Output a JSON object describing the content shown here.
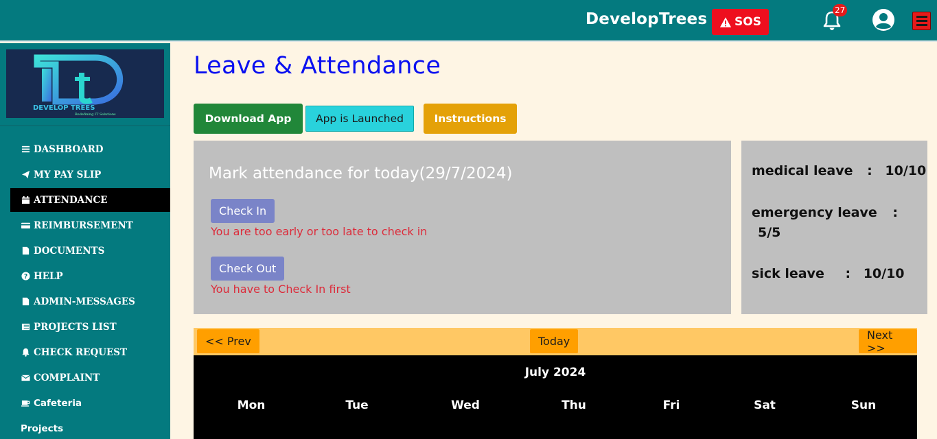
{
  "header": {
    "brand": "DevelopTrees",
    "sos_label": "SOS",
    "notification_count": "27"
  },
  "sidebar": {
    "logo_text": "DEVELOP TREES",
    "logo_tagline": "Redefining IT Solutions",
    "items": [
      {
        "label": "DASHBOARD",
        "icon": "bars-icon"
      },
      {
        "label": "MY PAY SLIP",
        "icon": "paper-plane-icon"
      },
      {
        "label": "ATTENDANCE",
        "icon": "calendar-icon",
        "active": true
      },
      {
        "label": "REIMBURSEMENT",
        "icon": "credit-card-icon"
      },
      {
        "label": "DOCUMENTS",
        "icon": "file-icon"
      },
      {
        "label": "HELP",
        "icon": "question-circle-icon"
      },
      {
        "label": "ADMIN-MESSAGES",
        "icon": "file-icon"
      },
      {
        "label": "PROJECTS LIST",
        "icon": "list-icon"
      },
      {
        "label": "CHECK REQUEST",
        "icon": "bell-icon"
      },
      {
        "label": "COMPLAINT",
        "icon": "envelope-icon"
      },
      {
        "label": "Cafeteria",
        "icon": "coffee-icon"
      },
      {
        "label": "Projects",
        "icon": ""
      }
    ]
  },
  "main": {
    "title": "Leave & Attendance",
    "download_label": "Download App",
    "launched_label": "App is Launched",
    "instructions_label": "Instructions",
    "attendance": {
      "title": "Mark attendance for today(29/7/2024)",
      "check_in_label": "Check In",
      "check_in_msg": "You are too early or too late to check in",
      "check_out_label": "Check Out",
      "check_out_msg": "You have to Check In first"
    },
    "leaves": [
      {
        "name": "medical leave",
        "sep": ":",
        "value": "10/10"
      },
      {
        "name": "emergency leave",
        "sep": ":",
        "value": "5/5"
      },
      {
        "name": "sick leave",
        "sep": ":",
        "value": "10/10"
      }
    ]
  },
  "calendar": {
    "prev_label": "<< Prev",
    "today_label": "Today",
    "next_label": "Next >>",
    "month_label": "July 2024",
    "days": [
      "Mon",
      "Tue",
      "Wed",
      "Thu",
      "Fri",
      "Sat",
      "Sun"
    ]
  },
  "colors": {
    "topbar": "#047a7f",
    "title": "#0a10f0",
    "sos": "#ee0f1e",
    "error_text": "#dc2b3a"
  }
}
